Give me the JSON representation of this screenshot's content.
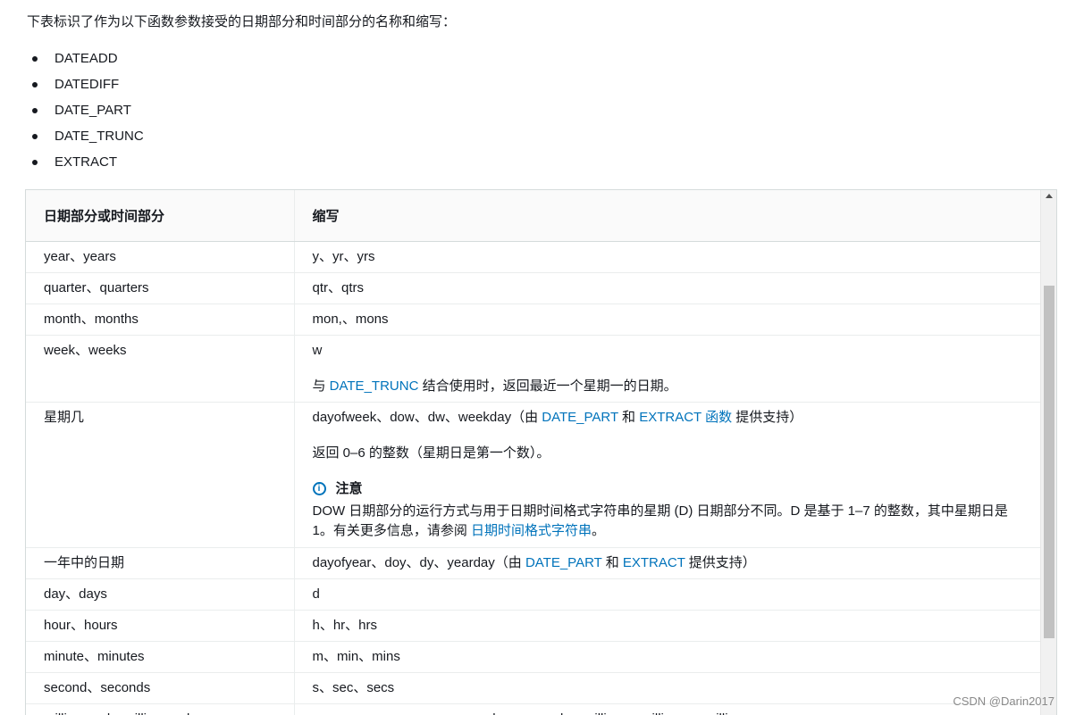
{
  "intro": "下表标识了作为以下函数参数接受的日期部分和时间部分的名称和缩写：",
  "functions": [
    "DATEADD",
    "DATEDIFF",
    "DATE_PART",
    "DATE_TRUNC",
    "EXTRACT"
  ],
  "table": {
    "headers": [
      "日期部分或时间部分",
      "缩写"
    ],
    "rows": [
      {
        "part": "year、years",
        "abbr": "y、yr、yrs"
      },
      {
        "part": "quarter、quarters",
        "abbr": "qtr、qtrs"
      },
      {
        "part": "month、months",
        "abbr": "mon,、mons"
      },
      {
        "part": "week、weeks",
        "abbr": "w",
        "extra_pre": "与 ",
        "extra_link": "DATE_TRUNC",
        "extra_post": " 结合使用时，返回最近一个星期一的日期。"
      },
      {
        "part": "星期几",
        "abbr_pre": "dayofweek、dow、dw、weekday（由 ",
        "abbr_link1": "DATE_PART",
        "abbr_mid": " 和 ",
        "abbr_link2": "EXTRACT 函数",
        "abbr_post": " 提供支持）",
        "p2": "返回 0–6 的整数（星期日是第一个数）。",
        "note_title": "注意",
        "note_pre": "DOW 日期部分的运行方式与用于日期时间格式字符串的星期 (D) 日期部分不同。D 是基于 1–7 的整数，其中星期日是 1。有关更多信息，请参阅 ",
        "note_link": "日期时间格式字符串",
        "note_post": "。"
      },
      {
        "part": "一年中的日期",
        "abbr_pre": "dayofyear、doy、dy、yearday（由 ",
        "abbr_link1": "DATE_PART",
        "abbr_mid": " 和 ",
        "abbr_link2": "EXTRACT",
        "abbr_post": " 提供支持）"
      },
      {
        "part": "day、days",
        "abbr": "d"
      },
      {
        "part": "hour、hours",
        "abbr": "h、hr、hrs"
      },
      {
        "part": "minute、minutes",
        "abbr": "m、min、mins"
      },
      {
        "part": "second、seconds",
        "abbr": "s、sec、secs"
      },
      {
        "part": "millisecond、milliseconds",
        "abbr": "ms、msec、msecs、msecond、mseconds、millisec、millisecs、millisecon"
      }
    ]
  },
  "watermark": "CSDN @Darin2017",
  "colors": {
    "link": "#0073bb",
    "text": "#16191f",
    "border": "#eaeded"
  },
  "icons": {
    "note": "info-icon",
    "scroll": "scroll-up-arrow-icon"
  }
}
